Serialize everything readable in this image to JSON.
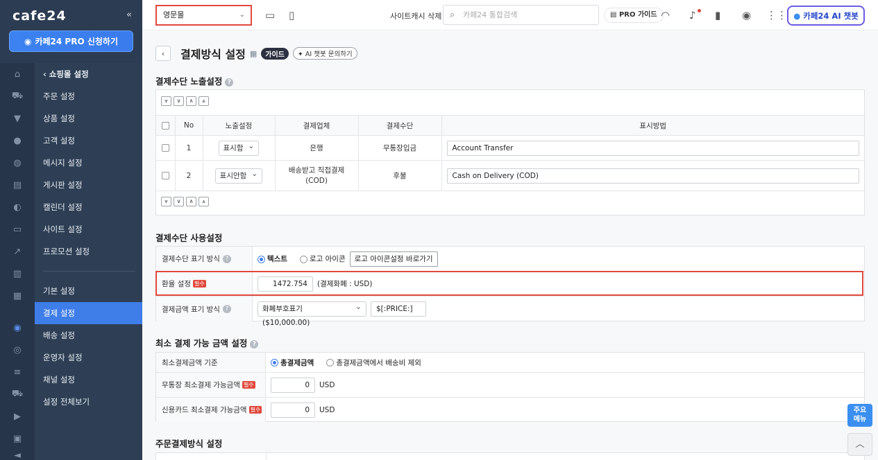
{
  "sidebar": {
    "logo": "cafe24",
    "collapse": "«",
    "pro_button": "카페24 PRO 신청하기",
    "back_item": "쇼핑몰 설정",
    "items_top": [
      "주문 설정",
      "상품 설정",
      "고객 설정",
      "메시지 설정",
      "게시판 설정",
      "캘린더 설정",
      "사이트 설정",
      "프로모션 설정"
    ],
    "items_bottom": [
      "기본 설정",
      "결제 설정",
      "배송 설정",
      "운영자 설정",
      "채널 설정",
      "설정 전체보기"
    ],
    "active": "결제 설정"
  },
  "topbar": {
    "shop_select": "영문몰",
    "cache_clear": "사이트캐시 삭제",
    "search_placeholder": "카페24 통합검색",
    "pro_guide": "PRO 가이드",
    "chatbot": "카페24 AI 챗봇"
  },
  "page": {
    "title": "결제방식 설정",
    "guide": "가이드",
    "ai_ask": "AI 챗봇 문의하기"
  },
  "section1": {
    "title": "결제수단 노출설정",
    "headers": [
      "No",
      "노출설정",
      "결제업체",
      "결제수단",
      "표시방법"
    ],
    "rows": [
      {
        "no": "1",
        "display": "표시함",
        "vendor": "은행",
        "method": "무통장입금",
        "label": "Account Transfer"
      },
      {
        "no": "2",
        "display": "표시안함",
        "vendor": "배송받고 직접결제\n(COD)",
        "method": "후불",
        "label": "Cash on Delivery (COD)"
      }
    ]
  },
  "section2": {
    "title": "결제수단 사용설정",
    "display_mode_label": "결제수단 표기 방식",
    "opt_text": "텍스트",
    "opt_logo": "로고 아이콘",
    "logo_shortcut": "로고 아이콘설정 바로가기",
    "rate_label": "환율 설정",
    "required": "필수",
    "rate_value": "1472.754",
    "rate_note": "(결제화폐 : USD)",
    "amount_label": "결제금액 표기 방식",
    "amount_select": "화폐부호표기 ($10,000.00)",
    "amount_format": "$[:PRICE:]"
  },
  "section3": {
    "title": "최소 결제 가능 금액 설정",
    "basis_label": "최소결제금액 기준",
    "opt_total": "총결제금액",
    "opt_exclude": "총결제금액에서 배송비 제외",
    "bank_label": "무통장 최소결제 가능금액",
    "bank_value": "0",
    "card_label": "신용카드 최소결제 가능금액",
    "card_value": "0",
    "currency": "USD"
  },
  "section4": {
    "title": "주문결제방식 설정"
  },
  "fab": {
    "main_menu": "주요\n메뉴",
    "up": "︿"
  }
}
